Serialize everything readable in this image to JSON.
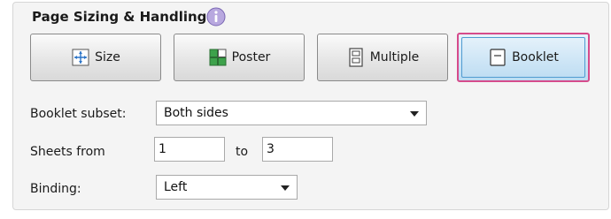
{
  "section": {
    "title": "Page Sizing & Handling",
    "info_icon": "info-icon"
  },
  "modes": [
    {
      "label": "Size",
      "icon": "size-icon"
    },
    {
      "label": "Poster",
      "icon": "poster-icon"
    },
    {
      "label": "Multiple",
      "icon": "multiple-icon"
    },
    {
      "label": "Booklet",
      "icon": "booklet-icon",
      "selected": true
    }
  ],
  "booklet_subset": {
    "label": "Booklet subset:",
    "value": "Both sides"
  },
  "sheets": {
    "label": "Sheets from",
    "from": "1",
    "to_label": "to",
    "to": "3"
  },
  "binding": {
    "label": "Binding:",
    "value": "Left"
  },
  "colors": {
    "accent_border": "#d64b8b",
    "selected_fill": "#cfe6f6",
    "info": "#9a86c6"
  }
}
